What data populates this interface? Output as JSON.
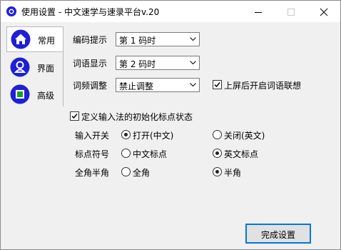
{
  "window": {
    "title": "使用设置 - 中文速学与速录平台v.20"
  },
  "sidebar": {
    "items": [
      {
        "label": "常用",
        "icon": "home-icon",
        "active": true
      },
      {
        "label": "界面",
        "icon": "user-icon",
        "active": false
      },
      {
        "label": "高级",
        "icon": "advanced-icon",
        "active": false
      }
    ]
  },
  "settings": {
    "encoding_hint": {
      "label": "编码提示",
      "value": "第 1 码时"
    },
    "word_display": {
      "label": "词语显示",
      "value": "第 2 码时"
    },
    "freq_adjust": {
      "label": "词频调整",
      "value": "禁止调整"
    },
    "association": {
      "label": "上屏后开启词语联想",
      "checked": true
    },
    "define_initial": {
      "label": "定义输入法的初始化标点状态",
      "checked": true
    }
  },
  "initial_state": {
    "input_switch": {
      "label": "输入开关",
      "options": [
        "打开(中文)",
        "关闭(英文)"
      ],
      "selected": 0
    },
    "punctuation": {
      "label": "标点符号",
      "options": [
        "中文标点",
        "英文标点"
      ],
      "selected": 1
    },
    "width": {
      "label": "全角半角",
      "options": [
        "全角",
        "半角"
      ],
      "selected": 1
    }
  },
  "footer": {
    "finish_label": "完成设置"
  },
  "colors": {
    "accent": "#0078d7",
    "icon_blue": "#1f1fd6",
    "icon_green": "#1a9e2a"
  }
}
